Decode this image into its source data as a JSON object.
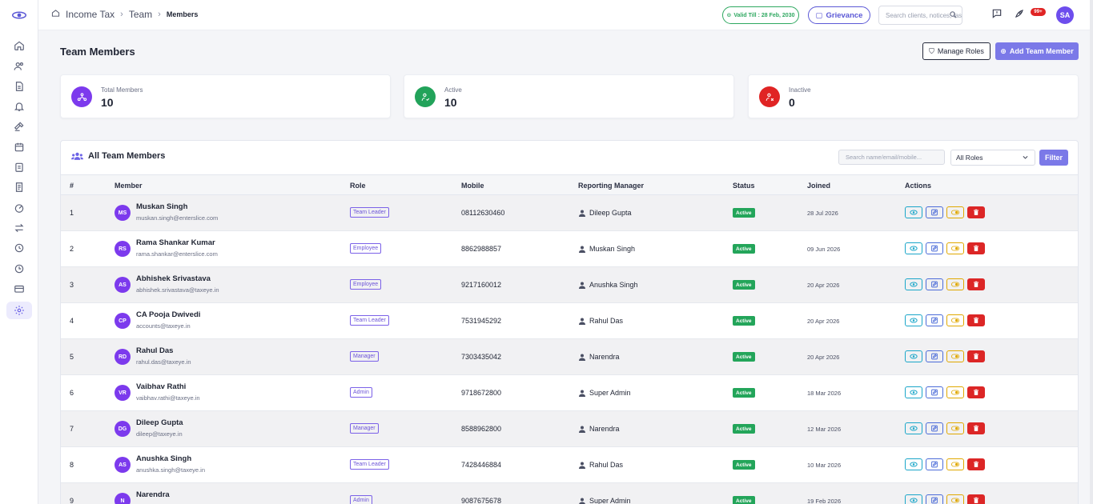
{
  "breadcrumb": {
    "items": [
      "Income Tax",
      "Team"
    ],
    "current": "Members"
  },
  "topbar": {
    "valid_till": "Valid Till : 28 Feb, 2030",
    "grievance": "Grievance",
    "search_placeholder": "Search clients, notices, tasks...",
    "notification_count": "99+",
    "user_initials": "SA"
  },
  "page": {
    "title": "Team Members",
    "manage_roles": "Manage Roles",
    "add_member": "Add Team Member"
  },
  "stats": [
    {
      "label": "Total Members",
      "value": "10",
      "color": "#7c3aed"
    },
    {
      "label": "Active",
      "value": "10",
      "color": "#22a35a"
    },
    {
      "label": "Inactive",
      "value": "0",
      "color": "#e02424"
    }
  ],
  "panel": {
    "title": "All Team Members",
    "search_placeholder": "Search name/email/mobile...",
    "role_filter": "All Roles",
    "filter_button": "Filter"
  },
  "table": {
    "columns": [
      "#",
      "Member",
      "Role",
      "Mobile",
      "Reporting Manager",
      "Status",
      "Joined",
      "Actions"
    ],
    "rows": [
      {
        "num": "1",
        "initials": "MS",
        "name": "Muskan Singh",
        "email": "muskan.singh@enterslice.com",
        "role": "Team Leader",
        "mobile": "08112630460",
        "manager": "Dileep Gupta",
        "status": "Active",
        "joined": "28 Jul 2026"
      },
      {
        "num": "2",
        "initials": "RS",
        "name": "Rama Shankar Kumar",
        "email": "rama.shankar@enterslice.com",
        "role": "Employee",
        "mobile": "8862988857",
        "manager": "Muskan Singh",
        "status": "Active",
        "joined": "09 Jun 2026"
      },
      {
        "num": "3",
        "initials": "AS",
        "name": "Abhishek Srivastava",
        "email": "abhishek.srivastava@taxeye.in",
        "role": "Employee",
        "mobile": "9217160012",
        "manager": "Anushka Singh",
        "status": "Active",
        "joined": "20 Apr 2026"
      },
      {
        "num": "4",
        "initials": "CP",
        "name": "CA Pooja Dwivedi",
        "email": "accounts@taxeye.in",
        "role": "Team Leader",
        "mobile": "7531945292",
        "manager": "Rahul Das",
        "status": "Active",
        "joined": "20 Apr 2026"
      },
      {
        "num": "5",
        "initials": "RD",
        "name": "Rahul Das",
        "email": "rahul.das@taxeye.in",
        "role": "Manager",
        "mobile": "7303435042",
        "manager": "Narendra",
        "status": "Active",
        "joined": "20 Apr 2026"
      },
      {
        "num": "6",
        "initials": "VR",
        "name": "Vaibhav Rathi",
        "email": "vaibhav.rathi@taxeye.in",
        "role": "Admin",
        "mobile": "9718672800",
        "manager": "Super Admin",
        "status": "Active",
        "joined": "18 Mar 2026"
      },
      {
        "num": "7",
        "initials": "DG",
        "name": "Dileep Gupta",
        "email": "dileep@taxeye.in",
        "role": "Manager",
        "mobile": "8588962800",
        "manager": "Narendra",
        "status": "Active",
        "joined": "12 Mar 2026"
      },
      {
        "num": "8",
        "initials": "AS",
        "name": "Anushka Singh",
        "email": "anushka.singh@taxeye.in",
        "role": "Team Leader",
        "mobile": "7428446884",
        "manager": "Rahul Das",
        "status": "Active",
        "joined": "10 Mar 2026"
      },
      {
        "num": "9",
        "initials": "N",
        "name": "Narendra",
        "email": "",
        "role": "Admin",
        "mobile": "9087675678",
        "manager": "Super Admin",
        "status": "Active",
        "joined": "19 Feb 2026"
      }
    ]
  }
}
